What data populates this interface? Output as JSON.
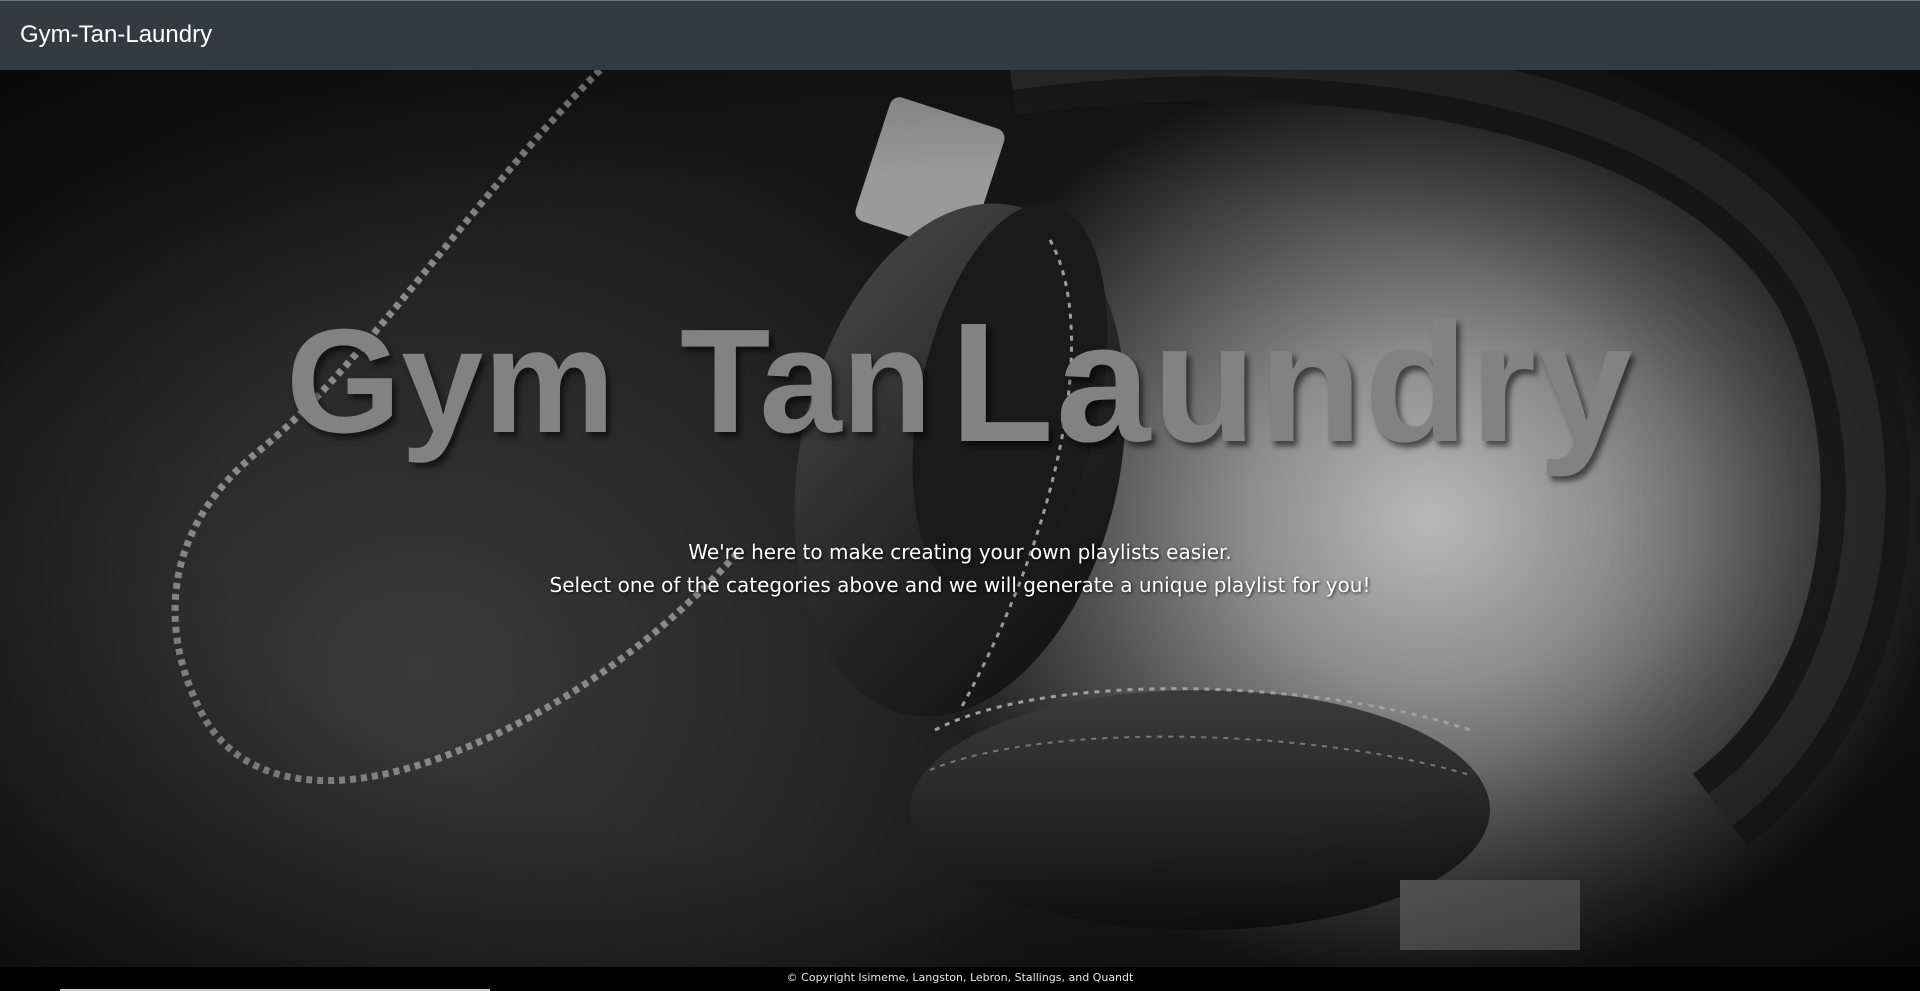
{
  "navbar": {
    "brand": "Gym-Tan-Laundry"
  },
  "hero": {
    "title_words": [
      "Gym",
      "Tan",
      "Laundry"
    ],
    "tagline_line1": "We're here to make creating your own playlists easier.",
    "tagline_line2": "Select one of the categories above and we will generate a unique playlist for you!",
    "background": "headphones-photo"
  },
  "footer": {
    "copyright": "© Copyright Isimeme, Langston, Lebron, Stallings, and Quandt"
  },
  "colors": {
    "navbar_bg": "#343a40",
    "title_text": "#828282",
    "footer_bg": "#000000",
    "text_light": "#ffffff"
  }
}
